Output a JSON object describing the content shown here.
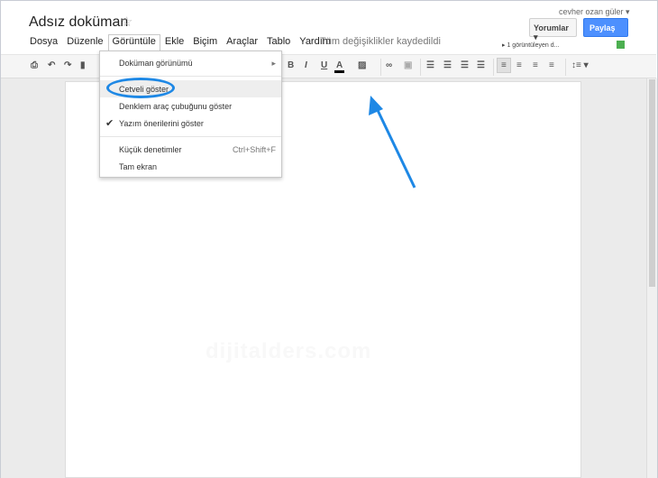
{
  "doc": {
    "title": "Adsız doküman",
    "saved_status": "Tüm değişiklikler kaydedildi"
  },
  "menubar": [
    "Dosya",
    "Düzenle",
    "Görüntüle",
    "Ekle",
    "Biçim",
    "Araçlar",
    "Tablo",
    "Yardım"
  ],
  "header": {
    "user": "cevher ozan güler ▾",
    "comments": "Yorumlar ▾",
    "share": "Paylaş",
    "viewers": "▸ 1 görüntüleyen d..."
  },
  "toolbar": {
    "bold": "B",
    "italic": "I",
    "underline": "U",
    "text_color": "A"
  },
  "view_menu": {
    "items": [
      {
        "label": "Doküman görünümü",
        "shortcut": "▸"
      },
      {
        "label": "Cetveli göster"
      },
      {
        "label": "Denklem araç çubuğunu göster"
      },
      {
        "label": "Yazım önerilerini göster",
        "checked": "✔"
      },
      {
        "label": "Küçük denetimler",
        "shortcut": "Ctrl+Shift+F"
      },
      {
        "label": "Tam ekran"
      }
    ]
  },
  "watermark": "dijitalders.com",
  "colors": {
    "accent": "#4d90fe",
    "annotation": "#1e88e5"
  }
}
